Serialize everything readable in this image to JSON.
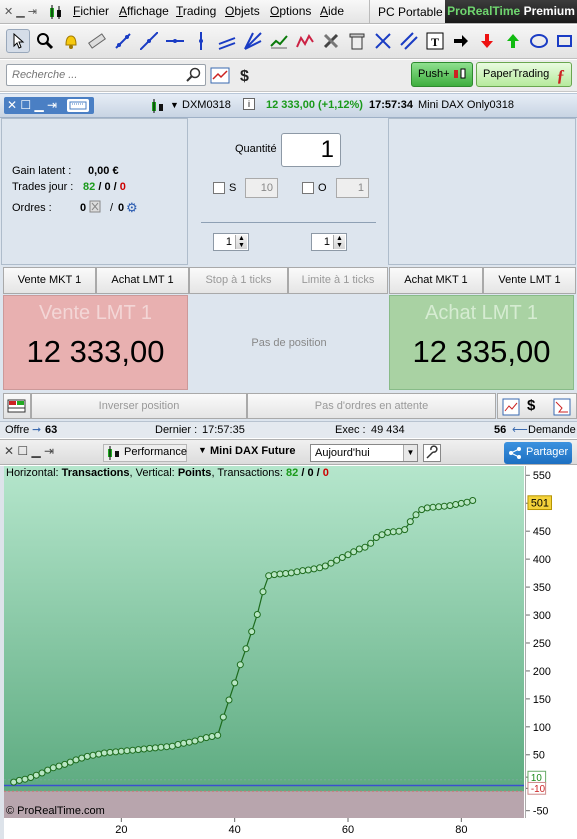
{
  "menu": {
    "items": [
      "Fichier",
      "Affichage",
      "Trading",
      "Objets",
      "Options",
      "Aide"
    ],
    "pc_portable": "PC Portable",
    "brand_a": "ProRealTime",
    "brand_b": "Premium"
  },
  "search": {
    "placeholder": "Recherche ..."
  },
  "buttons": {
    "push": "Push+",
    "paper": "PaperTrading"
  },
  "order_header": {
    "instrument": "DXM0318",
    "change": "12 333,00 (+1,12%)",
    "time": "17:57:34",
    "name": "Mini DAX Only0318"
  },
  "left_stats": {
    "gain_label": "Gain latent :",
    "gain_value": "0,00 €",
    "trades_label": "Trades jour :",
    "trades_a": "82",
    "trades_sep1": "/",
    "trades_b": "0",
    "trades_sep2": "/",
    "trades_c": "0",
    "orders_label": "Ordres :",
    "orders_a": "0",
    "orders_sep": "/",
    "orders_b": "0"
  },
  "quantity": {
    "label": "Quantité",
    "value": "1",
    "s_label": "S",
    "s_value": "10",
    "o_label": "O",
    "o_value": "1",
    "spin_left": "1",
    "spin_right": "1"
  },
  "order_buttons": {
    "vente_mkt": "Vente MKT 1",
    "achat_lmt_left": "Achat LMT 1",
    "stop": "Stop à 1 ticks",
    "limite": "Limite à 1 ticks",
    "achat_mkt": "Achat MKT 1",
    "vente_lmt_right": "Vente LMT 1"
  },
  "sell_box": {
    "title": "Vente LMT 1",
    "price": "12 333,00"
  },
  "buy_box": {
    "title": "Achat LMT 1",
    "price": "12 335,00"
  },
  "no_position": "Pas de position",
  "bottom_buttons": {
    "reverse": "Inverser position",
    "no_orders": "Pas d'ordres en attente"
  },
  "status": {
    "offre_label": "Offre",
    "offre_value": "63",
    "dernier_label": "Dernier :",
    "dernier_value": "17:57:35",
    "exec_label": "Exec :",
    "exec_value": "49 434",
    "demande_value": "56",
    "demande_label": "Demande"
  },
  "chart_header": {
    "performance": "Performance",
    "instrument": "Mini DAX Future",
    "period": "Aujourd'hui",
    "share": "Partager"
  },
  "chart_info": {
    "h_label": "Horizontal:",
    "h_value": "Transactions",
    "v_label": ", Vertical:",
    "v_value": "Points",
    "t_label": ", Transactions:",
    "t_a": "82",
    "t_sep1": "/",
    "t_b": "0",
    "t_sep2": "/",
    "t_c": "0"
  },
  "watermark": "© ProRealTime.com",
  "colors": {
    "accent": "#4a7fc4",
    "green": "#1a9a1a",
    "red": "#cc0000",
    "line": "#1d6b1d"
  },
  "chart_data": {
    "type": "line",
    "x": [
      1,
      2,
      3,
      4,
      5,
      6,
      7,
      8,
      9,
      10,
      11,
      12,
      13,
      14,
      15,
      16,
      17,
      18,
      19,
      20,
      21,
      22,
      23,
      24,
      25,
      26,
      27,
      28,
      29,
      30,
      31,
      32,
      33,
      34,
      35,
      36,
      37,
      38,
      39,
      40,
      41,
      42,
      43,
      44,
      45,
      46,
      47,
      48,
      49,
      50,
      51,
      52,
      53,
      54,
      55,
      56,
      57,
      58,
      59,
      60,
      61,
      62,
      63,
      64,
      65,
      66,
      67,
      68,
      69,
      70,
      71,
      72,
      73,
      74,
      75,
      76,
      77,
      78,
      79,
      80,
      81,
      82
    ],
    "y": [
      6,
      9,
      11,
      14,
      18,
      22,
      27,
      31,
      34,
      37,
      41,
      45,
      48,
      51,
      53,
      55,
      57,
      58,
      59,
      60,
      61,
      62,
      63,
      64,
      65,
      66,
      67,
      68,
      69,
      72,
      74,
      76,
      78,
      81,
      84,
      86,
      88,
      120,
      150,
      180,
      212,
      240,
      270,
      300,
      340,
      368,
      370,
      371,
      372,
      373,
      375,
      377,
      378,
      380,
      382,
      385,
      390,
      395,
      400,
      405,
      410,
      415,
      418,
      425,
      435,
      440,
      444,
      445,
      446,
      449,
      463,
      475,
      484,
      487,
      488,
      489,
      490,
      491,
      493,
      495,
      497,
      500
    ],
    "ylim": [
      -50,
      550
    ],
    "yticks": [
      550,
      500,
      450,
      400,
      350,
      300,
      250,
      200,
      150,
      100,
      50,
      10,
      -10,
      -50
    ],
    "xticks": [
      20,
      40,
      60,
      80
    ],
    "xlim": [
      0,
      90
    ],
    "last_value": "501",
    "markers": {
      "pos": "10",
      "neg": "-10"
    },
    "xlabel": "Transactions",
    "ylabel": "Points"
  }
}
